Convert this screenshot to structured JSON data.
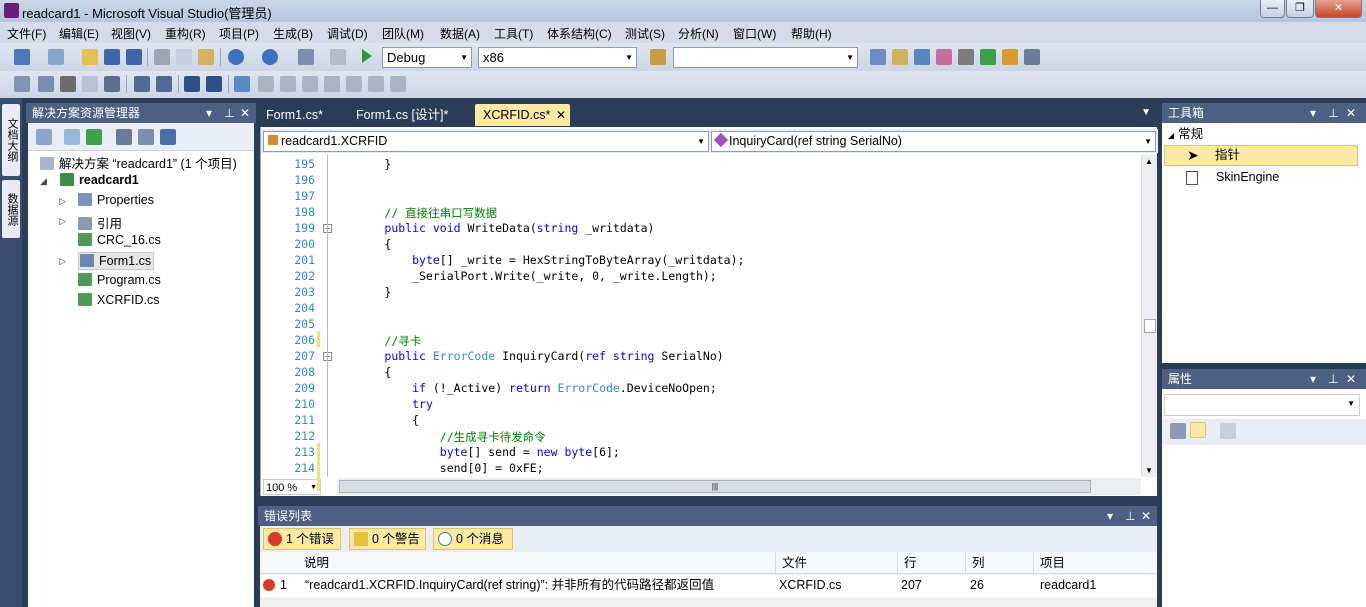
{
  "window": {
    "title": "readcard1 - Microsoft Visual Studio(管理员)",
    "minimize": "—",
    "maximize": "❐",
    "close": "✕"
  },
  "menu": [
    "文件(F)",
    "编辑(E)",
    "视图(V)",
    "重构(R)",
    "项目(P)",
    "生成(B)",
    "调试(D)",
    "团队(M)",
    "数据(A)",
    "工具(T)",
    "体系结构(C)",
    "测试(S)",
    "分析(N)",
    "窗口(W)",
    "帮助(H)"
  ],
  "toolbar": {
    "config": "Debug",
    "platform": "x86",
    "find_value": ""
  },
  "left_tabs": [
    "文档大纲",
    "数据源"
  ],
  "solution_explorer": {
    "title": "解决方案资源管理器",
    "items": [
      {
        "label": "解决方案 “readcard1” (1 个项目)",
        "icon": "solution-icon"
      },
      {
        "label": "readcard1",
        "icon": "csharp-project-icon"
      },
      {
        "label": "Properties",
        "icon": "properties-icon"
      },
      {
        "label": "引用",
        "icon": "references-icon"
      },
      {
        "label": "CRC_16.cs",
        "icon": "cs-file-icon"
      },
      {
        "label": "Form1.cs",
        "icon": "form-icon"
      },
      {
        "label": "Program.cs",
        "icon": "cs-file-icon"
      },
      {
        "label": "XCRFID.cs",
        "icon": "cs-file-icon"
      }
    ]
  },
  "doc_tabs": [
    {
      "label": "Form1.cs*",
      "active": false
    },
    {
      "label": "Form1.cs [设计]*",
      "active": false
    },
    {
      "label": "XCRFID.cs*",
      "active": true
    }
  ],
  "editor": {
    "class_combo": "readcard1.XCRFID",
    "member_combo": "InquiryCard(ref string SerialNo)",
    "zoom": "100 %",
    "lines": [
      {
        "n": "195",
        "t": "        }"
      },
      {
        "n": "196",
        "t": ""
      },
      {
        "n": "197",
        "t": ""
      },
      {
        "n": "198",
        "t": "        // 直接往串口写数据"
      },
      {
        "n": "199",
        "t": "        public void WriteData(string _writdata)"
      },
      {
        "n": "200",
        "t": "        {"
      },
      {
        "n": "201",
        "t": "            byte[] _write = HexStringToByteArray(_writdata);"
      },
      {
        "n": "202",
        "t": "            _SerialPort.Write(_write, 0, _write.Length);"
      },
      {
        "n": "203",
        "t": "        }"
      },
      {
        "n": "204",
        "t": ""
      },
      {
        "n": "205",
        "t": ""
      },
      {
        "n": "206",
        "t": "        //寻卡"
      },
      {
        "n": "207",
        "t": "        public ErrorCode InquiryCard(ref string SerialNo)"
      },
      {
        "n": "208",
        "t": "        {"
      },
      {
        "n": "209",
        "t": "            if (!_Active) return ErrorCode.DeviceNoOpen;"
      },
      {
        "n": "210",
        "t": "            try"
      },
      {
        "n": "211",
        "t": "            {"
      },
      {
        "n": "212",
        "t": "                //生成寻卡待发命令"
      },
      {
        "n": "213",
        "t": "                byte[] send = new byte[6];"
      },
      {
        "n": "214",
        "t": "                send[0] = 0xFE;"
      }
    ]
  },
  "toolbox": {
    "title": "工具箱",
    "group": "常规",
    "items": [
      "指针",
      "SkinEngine"
    ]
  },
  "properties": {
    "title": "属性"
  },
  "error_list": {
    "title": "错误列表",
    "errors_btn": "1 个错误",
    "warnings_btn": "0 个警告",
    "messages_btn": "0 个消息",
    "columns": [
      "说明",
      "文件",
      "行",
      "列",
      "项目"
    ],
    "rows": [
      {
        "num": "1",
        "desc": "“readcard1.XCRFID.InquiryCard(ref string)”: 并非所有的代码路径都返回值",
        "file": "XCRFID.cs",
        "line": "207",
        "col": "26",
        "project": "readcard1"
      }
    ]
  }
}
